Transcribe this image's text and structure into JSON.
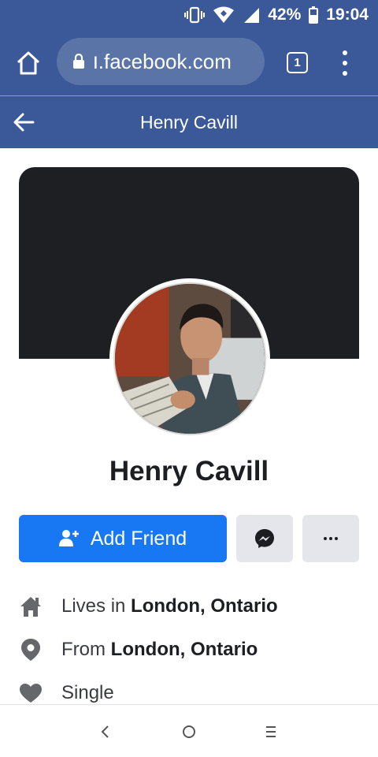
{
  "status_bar": {
    "battery": "42%",
    "time": "19:04"
  },
  "browser": {
    "url": "ו.facebook.com",
    "tab_count": "1"
  },
  "header": {
    "title": "Henry Cavill"
  },
  "profile": {
    "name": "Henry Cavill",
    "add_friend_label": "Add Friend"
  },
  "details": [
    {
      "icon": "home-icon",
      "prefix": "Lives in ",
      "value": "London, Ontario"
    },
    {
      "icon": "location-pin-icon",
      "prefix": "From ",
      "value": "London, Ontario"
    },
    {
      "icon": "heart-icon",
      "prefix": "",
      "value": "Single"
    }
  ],
  "colors": {
    "brand": "#3b5998",
    "primary_button": "#1877f2",
    "secondary_button": "#e4e6eb",
    "cover": "#1e1f22"
  }
}
